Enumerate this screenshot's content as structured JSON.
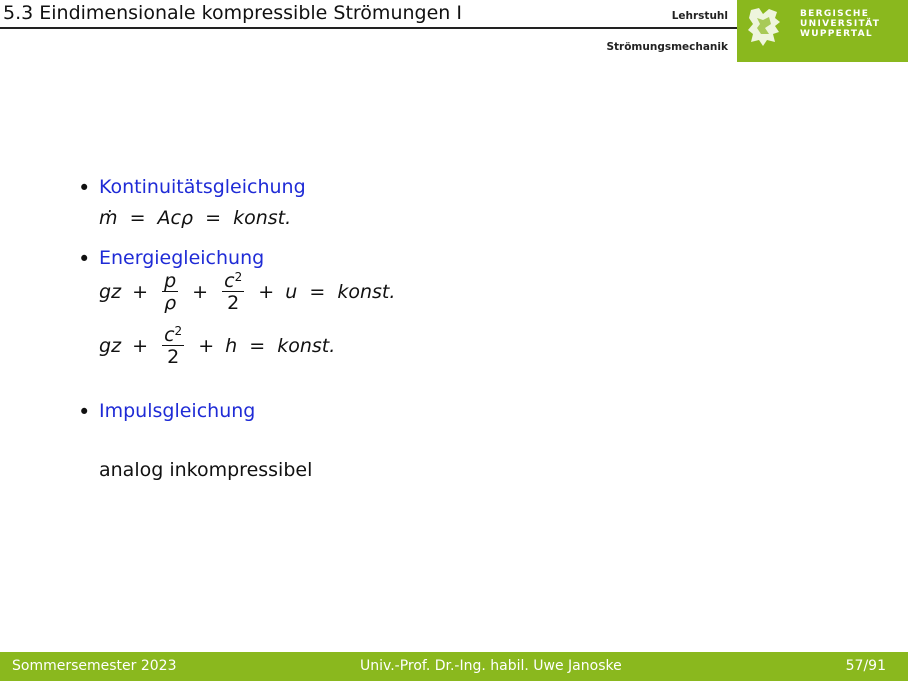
{
  "header": {
    "title": "5.3 Eindimensionale kompressible Strömungen I",
    "chair_line1": "Lehrstuhl",
    "chair_line2": "Strömungsmechanik",
    "university": [
      "BERGISCHE",
      "UNIVERSITÄT",
      "WUPPERTAL"
    ],
    "logo_icon": "lion-emblem-icon",
    "accent_color": "#8ab81e",
    "heading_color": "#1f2bd6"
  },
  "content": {
    "items": [
      {
        "heading": "Kontinuitätsgleichung",
        "equations": [
          "ṁ = Acρ = konst."
        ]
      },
      {
        "heading": "Energiegleichung",
        "equations": [
          "gz + p/ρ + c²/2 + u = konst.",
          "gz + c²/2 + h = konst."
        ]
      },
      {
        "heading": "Impulsgleichung",
        "note": "analog inkompressibel"
      }
    ],
    "tokens": {
      "mdot": "ṁ",
      "eq": "=",
      "plus": "+",
      "A": "A",
      "c": "c",
      "rho": "ρ",
      "p": "p",
      "two": "2",
      "g": "g",
      "z": "z",
      "u": "u",
      "h": "h",
      "sq": "2",
      "konst": "konst.",
      "bullet": "•"
    }
  },
  "footer": {
    "semester": "Sommersemester 2023",
    "author": "Univ.-Prof. Dr.-Ing. habil. Uwe Janoske",
    "page": "57/91"
  }
}
